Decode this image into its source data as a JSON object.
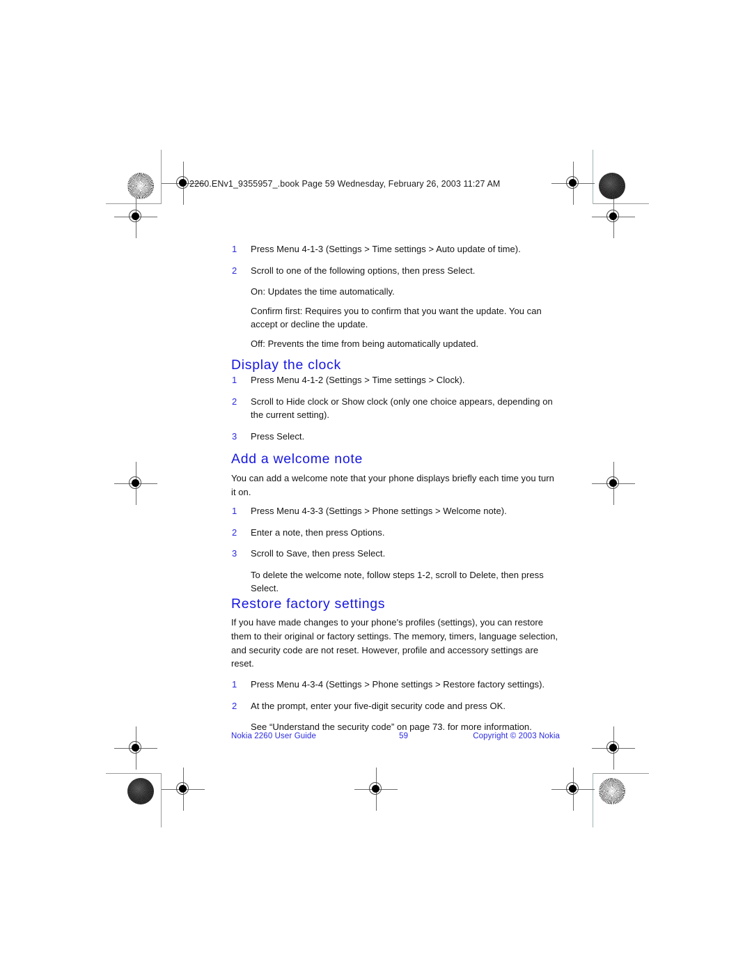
{
  "header": {
    "file_info": "2260.ENv1_9355957_.book  Page 59  Wednesday, February 26, 2003  11:27 AM"
  },
  "content": {
    "auto_update_steps": [
      {
        "num": "1",
        "text": "Press Menu 4-1-3 (Settings > Time settings > Auto update of time)."
      },
      {
        "num": "2",
        "text": "Scroll to one of the following options, then press Select."
      }
    ],
    "auto_update_options": [
      "On: Updates the time automatically.",
      "Confirm first: Requires you to confirm that you want the update. You can accept or decline the update.",
      "Off: Prevents the time from being automatically updated."
    ],
    "display_clock": {
      "title": "Display the clock",
      "steps": [
        {
          "num": "1",
          "text": "Press Menu 4-1-2 (Settings > Time settings > Clock)."
        },
        {
          "num": "2",
          "text": "Scroll to Hide clock or Show clock (only one choice appears, depending on the current setting)."
        },
        {
          "num": "3",
          "text": "Press Select."
        }
      ]
    },
    "welcome_note": {
      "title": "Add a welcome note",
      "intro": "You can add a welcome note that your phone displays briefly each time you turn it on.",
      "steps": [
        {
          "num": "1",
          "text": "Press Menu 4-3-3 (Settings > Phone settings > Welcome note)."
        },
        {
          "num": "2",
          "text": "Enter a note, then press Options."
        },
        {
          "num": "3",
          "text": "Scroll to Save, then press Select."
        }
      ],
      "footnote": "To delete the welcome note, follow steps 1-2, scroll to Delete, then press Select."
    },
    "restore_factory": {
      "title": "Restore factory settings",
      "intro": "If you have made changes to your phone's profiles (settings), you can restore them to their original or factory settings. The memory, timers, language selection, and security code are not reset. However, profile and accessory settings are reset.",
      "steps": [
        {
          "num": "1",
          "text": "Press Menu 4-3-4 (Settings > Phone settings > Restore factory settings)."
        },
        {
          "num": "2",
          "text": "At the prompt, enter your five-digit security code and press OK."
        }
      ],
      "footnote": "See “Understand the security code” on page 73. for more information."
    }
  },
  "footer": {
    "left": "Nokia 2260 User Guide",
    "page_number": "59",
    "right": "Copyright © 2003 Nokia"
  },
  "colors": {
    "heading_blue": "#1717e0",
    "footer_blue": "#2a2ae0",
    "body_black": "#141414"
  }
}
